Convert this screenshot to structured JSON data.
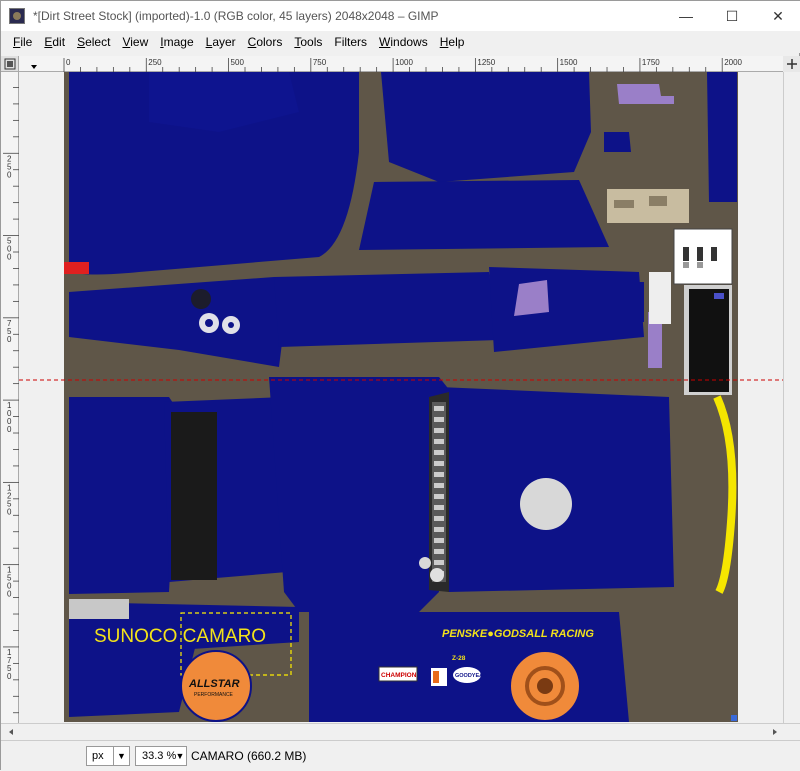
{
  "window": {
    "title": "*[Dirt Street Stock] (imported)-1.0 (RGB color, 45 layers) 2048x2048 – GIMP",
    "controls": {
      "minimize": "—",
      "maximize": "☐",
      "close": "✕"
    }
  },
  "menubar": {
    "items": [
      {
        "underline": "F",
        "rest": "ile"
      },
      {
        "underline": "E",
        "rest": "dit"
      },
      {
        "underline": "S",
        "rest": "elect"
      },
      {
        "underline": "V",
        "rest": "iew"
      },
      {
        "underline": "I",
        "rest": "mage"
      },
      {
        "underline": "L",
        "rest": "ayer"
      },
      {
        "underline": "C",
        "rest": "olors"
      },
      {
        "underline": "T",
        "rest": "ools"
      },
      {
        "underline": "",
        "rest": "Filters"
      },
      {
        "underline": "W",
        "rest": "indows"
      },
      {
        "underline": "H",
        "rest": "elp"
      }
    ]
  },
  "rulers": {
    "horizontal_labels": [
      "0",
      "250",
      "500",
      "750",
      "1000",
      "1250",
      "1500",
      "1750",
      "2000"
    ],
    "vertical_labels": [
      "250",
      "500",
      "750",
      "1000",
      "1250",
      "1500",
      "1750"
    ]
  },
  "canvas": {
    "texture_text": {
      "sponsor_left": "SUNOCO CAMARO",
      "sponsor_right": "PENSKE●GODSALL RACING",
      "allstar": "ALLSTAR",
      "allstar_sub": "PERFORMANCE",
      "champion": "CHAMPION",
      "z28": "Z-28",
      "goodyear": "GOODYEAR"
    },
    "colors": {
      "background": "#5f5648",
      "body_blue": "#0d1288",
      "tire_orange": "#f08a3a",
      "stripe_yellow": "#f5e600",
      "text_yellow": "#f2e21a",
      "lavender": "#9a7fc8",
      "tan": "#c8bca0",
      "red": "#e02020",
      "guide": "#cc0000"
    }
  },
  "statusbar": {
    "unit": "px",
    "zoom": "33.3 %",
    "status": "CAMARO (660.2 MB)"
  }
}
